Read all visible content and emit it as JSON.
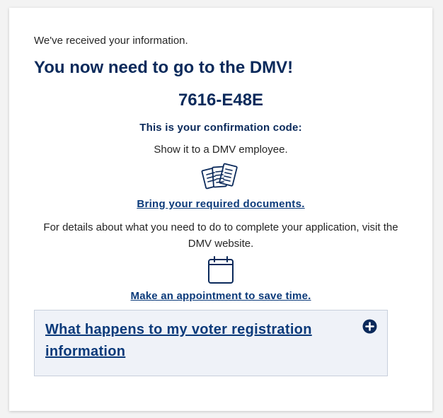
{
  "status": {
    "received": "We've received your information.",
    "headline": "You now need to go to the DMV!"
  },
  "confirmation": {
    "code": "7616-E48E",
    "label": "This is your confirmation code:",
    "instruction": "Show it to a DMV employee."
  },
  "documents": {
    "icon": "documents-icon",
    "link_label": "Bring your required documents."
  },
  "details": {
    "text": "For details about what you need to do to complete your application, visit the DMV website."
  },
  "appointment": {
    "icon": "calendar-icon",
    "link_label": "Make an appointment to save time."
  },
  "accordion": {
    "title": "What happens to my voter registration information",
    "icon": "plus-circle-icon",
    "expanded": false
  },
  "colors": {
    "primary": "#0b2a5b",
    "link": "#0b3a7a",
    "accordion_bg": "#eff2f8",
    "text": "#262626"
  }
}
